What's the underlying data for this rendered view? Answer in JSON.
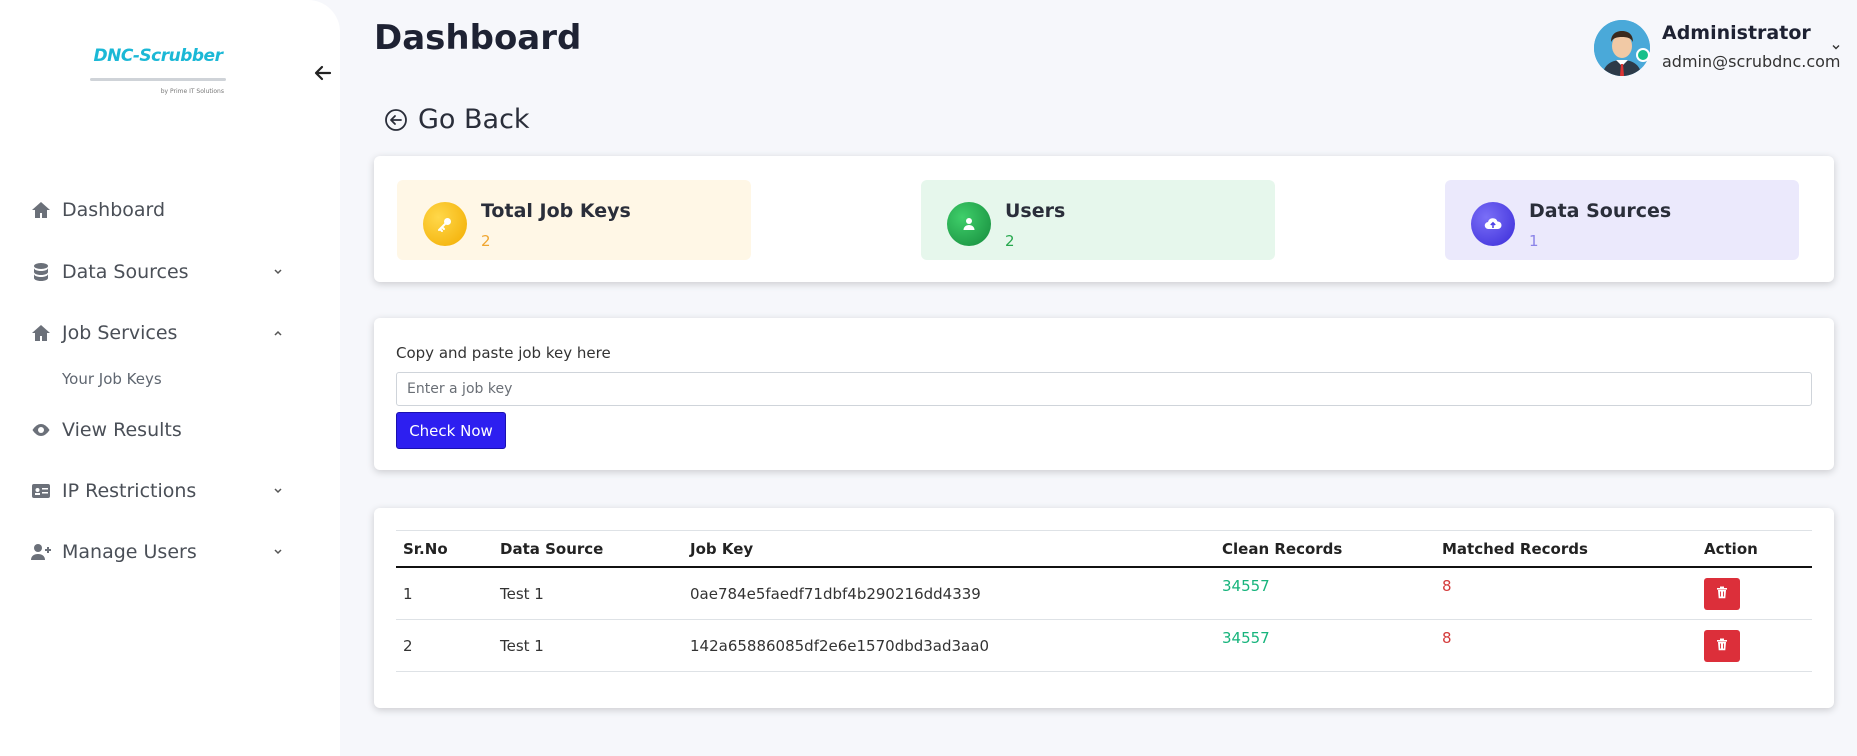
{
  "brand": {
    "name": "DNC-Scrubber",
    "tagline": "by Prime IT Solutions",
    "color": "#1bb8d6"
  },
  "sidebar": {
    "items": [
      {
        "label": "Dashboard",
        "icon": "home-icon"
      },
      {
        "label": "Data Sources",
        "icon": "database-icon",
        "chevron": "down"
      },
      {
        "label": "Job Services",
        "icon": "home-icon",
        "chevron": "up",
        "subitems": [
          {
            "label": "Your Job Keys"
          }
        ]
      },
      {
        "label": "View Results",
        "icon": "eye-icon"
      },
      {
        "label": "IP Restrictions",
        "icon": "id-card-icon",
        "chevron": "down"
      },
      {
        "label": "Manage Users",
        "icon": "user-plus-icon",
        "chevron": "down"
      }
    ]
  },
  "header": {
    "title": "Dashboard",
    "user": {
      "name": "Administrator",
      "email": "admin@scrubdnc.com",
      "status_color": "#17c08a"
    }
  },
  "go_back": {
    "label": "Go Back"
  },
  "stats": [
    {
      "title": "Total Job Keys",
      "value": "2",
      "icon": "key-icon",
      "bg": "#fff7e6",
      "icon_color": "#f5b40a",
      "value_color": "#f0a630"
    },
    {
      "title": "Users",
      "value": "2",
      "icon": "user-icon",
      "bg": "#e6f7ec",
      "icon_color": "#1a9f4a",
      "value_color": "#27a84e"
    },
    {
      "title": "Data Sources",
      "value": "1",
      "icon": "cloud-upload-icon",
      "bg": "#ebe9fc",
      "icon_color": "#4a3ee6",
      "value_color": "#8a83e8"
    }
  ],
  "form": {
    "label": "Copy and paste job key here",
    "placeholder": "Enter a job key",
    "value": "",
    "button": "Check Now",
    "button_color": "#2d1ff0"
  },
  "table": {
    "headers": [
      "Sr.No",
      "Data Source",
      "Job Key",
      "Clean Records",
      "Matched Records",
      "Action"
    ],
    "rows": [
      {
        "sr": "1",
        "source": "Test 1",
        "job_key": "0ae784e5faedf71dbf4b290216dd4339",
        "clean": "34557",
        "matched": "8"
      },
      {
        "sr": "2",
        "source": "Test 1",
        "job_key": "142a65886085df2e6e1570dbd3ad3aa0",
        "clean": "34557",
        "matched": "8"
      }
    ]
  }
}
